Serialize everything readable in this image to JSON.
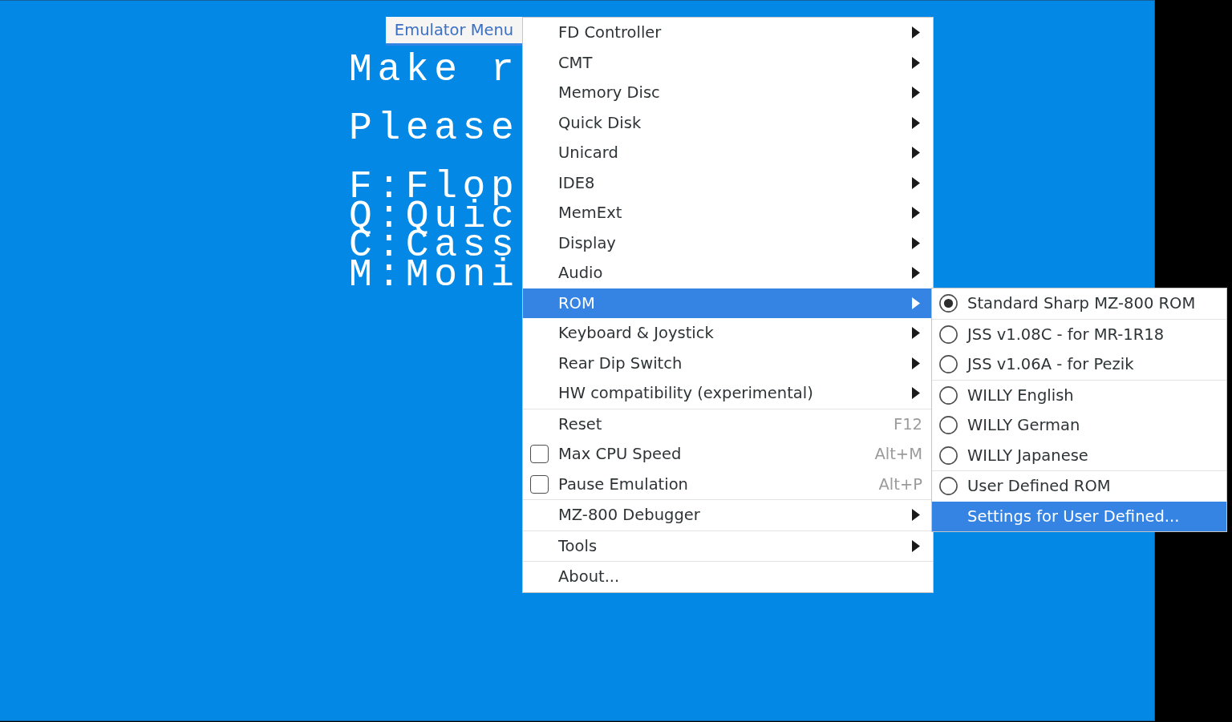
{
  "emulator_screen": {
    "paragraphs": [
      {
        "lines": [
          "Make r"
        ]
      },
      {
        "lines": [
          "Please"
        ]
      },
      {
        "lines": [
          "F:Flop",
          "Q:Quic",
          "C:Cass",
          "M:Moni"
        ]
      }
    ]
  },
  "menu_button": {
    "label": "Emulator Menu",
    "expanded": true
  },
  "menu": {
    "groups": [
      {
        "items": [
          {
            "kind": "submenu",
            "label": "FD Controller",
            "selected": false
          },
          {
            "kind": "submenu",
            "label": "CMT",
            "selected": false
          },
          {
            "kind": "submenu",
            "label": "Memory Disc",
            "selected": false
          },
          {
            "kind": "submenu",
            "label": "Quick Disk",
            "selected": false
          },
          {
            "kind": "submenu",
            "label": "Unicard",
            "selected": false
          },
          {
            "kind": "submenu",
            "label": "IDE8",
            "selected": false
          },
          {
            "kind": "submenu",
            "label": "MemExt",
            "selected": false
          },
          {
            "kind": "submenu",
            "label": "Display",
            "selected": false
          },
          {
            "kind": "submenu",
            "label": "Audio",
            "selected": false
          },
          {
            "kind": "submenu",
            "label": "ROM",
            "selected": true
          },
          {
            "kind": "submenu",
            "label": "Keyboard & Joystick",
            "selected": false
          },
          {
            "kind": "submenu",
            "label": "Rear Dip Switch",
            "selected": false
          },
          {
            "kind": "submenu",
            "label": "HW compatibility (experimental)",
            "selected": false
          }
        ]
      },
      {
        "items": [
          {
            "kind": "action",
            "label": "Reset",
            "shortcut": "F12",
            "selected": false
          },
          {
            "kind": "checkbox",
            "label": "Max CPU Speed",
            "checked": false,
            "shortcut": "Alt+M",
            "selected": false
          },
          {
            "kind": "checkbox",
            "label": "Pause Emulation",
            "checked": false,
            "shortcut": "Alt+P",
            "selected": false
          }
        ]
      },
      {
        "items": [
          {
            "kind": "submenu",
            "label": "MZ-800 Debugger",
            "selected": false
          }
        ]
      },
      {
        "items": [
          {
            "kind": "submenu",
            "label": "Tools",
            "selected": false
          }
        ]
      },
      {
        "items": [
          {
            "kind": "action",
            "label": "About...",
            "selected": false
          }
        ]
      }
    ]
  },
  "submenu": {
    "groups": [
      {
        "items": [
          {
            "kind": "radio",
            "label": "Standard Sharp MZ-800 ROM",
            "checked": true,
            "selected": false
          }
        ]
      },
      {
        "items": [
          {
            "kind": "radio",
            "label": "JSS v1.08C - for MR-1R18",
            "checked": false,
            "selected": false
          },
          {
            "kind": "radio",
            "label": "JSS v1.06A - for Pezik",
            "checked": false,
            "selected": false
          }
        ]
      },
      {
        "items": [
          {
            "kind": "radio",
            "label": "WILLY English",
            "checked": false,
            "selected": false
          },
          {
            "kind": "radio",
            "label": "WILLY German",
            "checked": false,
            "selected": false
          },
          {
            "kind": "radio",
            "label": "WILLY Japanese",
            "checked": false,
            "selected": false
          }
        ]
      },
      {
        "items": [
          {
            "kind": "radio",
            "label": "User Defined ROM",
            "checked": false,
            "selected": false
          },
          {
            "kind": "action",
            "label": "Settings for User Defined...",
            "selected": true
          }
        ]
      }
    ]
  }
}
